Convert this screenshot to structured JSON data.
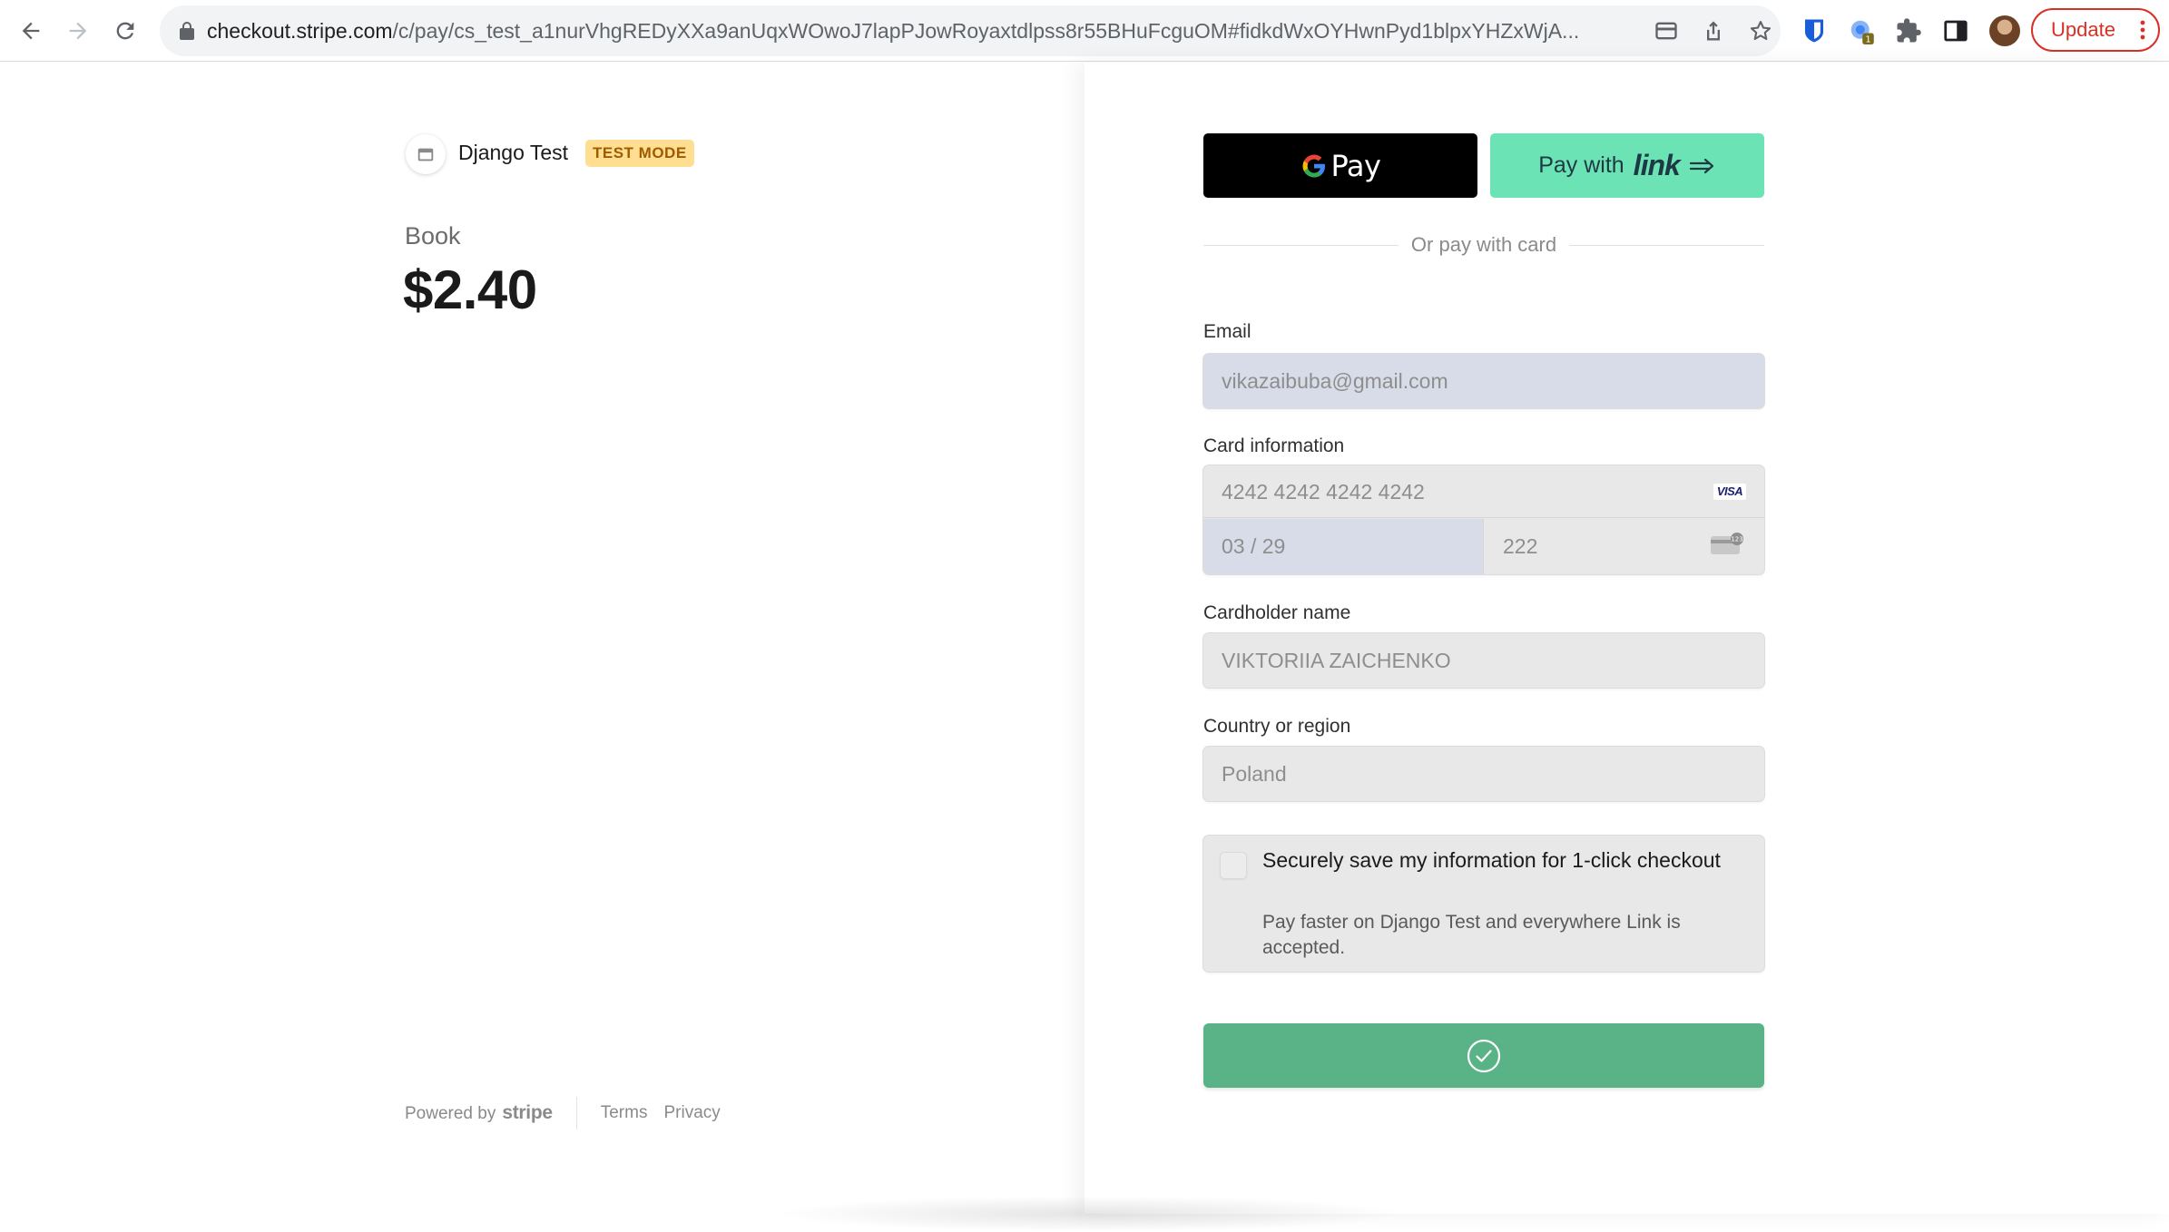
{
  "browser": {
    "url_host": "checkout.stripe.com",
    "url_path": "/c/pay/cs_test_a1nurVhgREDyXXa9anUqxWOwoJ7lapPJowRoyaxtdlpss8r55BHuFcguOM#fidkdWxOYHwnPyd1blpxYHZxWjA...",
    "update_label": "Update",
    "extension_badge": "1",
    "icons": [
      "back-icon",
      "forward-icon",
      "reload-icon",
      "lock-icon",
      "card-icon",
      "share-icon",
      "star-icon",
      "bitwarden-icon",
      "extension-icon",
      "puzzle-icon",
      "sidepanel-icon",
      "avatar",
      "more-icon"
    ]
  },
  "merchant": {
    "name": "Django Test",
    "badge": "TEST MODE"
  },
  "product": {
    "name": "Book",
    "price": "$2.40"
  },
  "footer": {
    "powered_by": "Powered by",
    "brand": "stripe",
    "terms": "Terms",
    "privacy": "Privacy"
  },
  "express": {
    "gpay_label": "Pay",
    "link_pay": "Pay with",
    "link_word": "link"
  },
  "divider": "Or pay with card",
  "form": {
    "email_label": "Email",
    "email_value": "vikazaibuba@gmail.com",
    "card_label": "Card information",
    "card_number": "4242 4242 4242 4242",
    "card_brand": "VISA",
    "card_expiry": "03 / 29",
    "card_cvc": "222",
    "cardholder_label": "Cardholder name",
    "cardholder_value": "VIKTORIIA ZAICHENKO",
    "country_label": "Country or region",
    "country_value": "Poland",
    "save_title": "Securely save my information for 1-click checkout",
    "save_desc": "Pay faster on Django Test and everywhere Link is accepted.",
    "save_checked": false
  },
  "colors": {
    "pay_button": "#59b386",
    "link_button": "#6ce3b4",
    "test_badge_bg": "#ffde92",
    "test_badge_text": "#a05a00",
    "update_red": "#d93025"
  }
}
